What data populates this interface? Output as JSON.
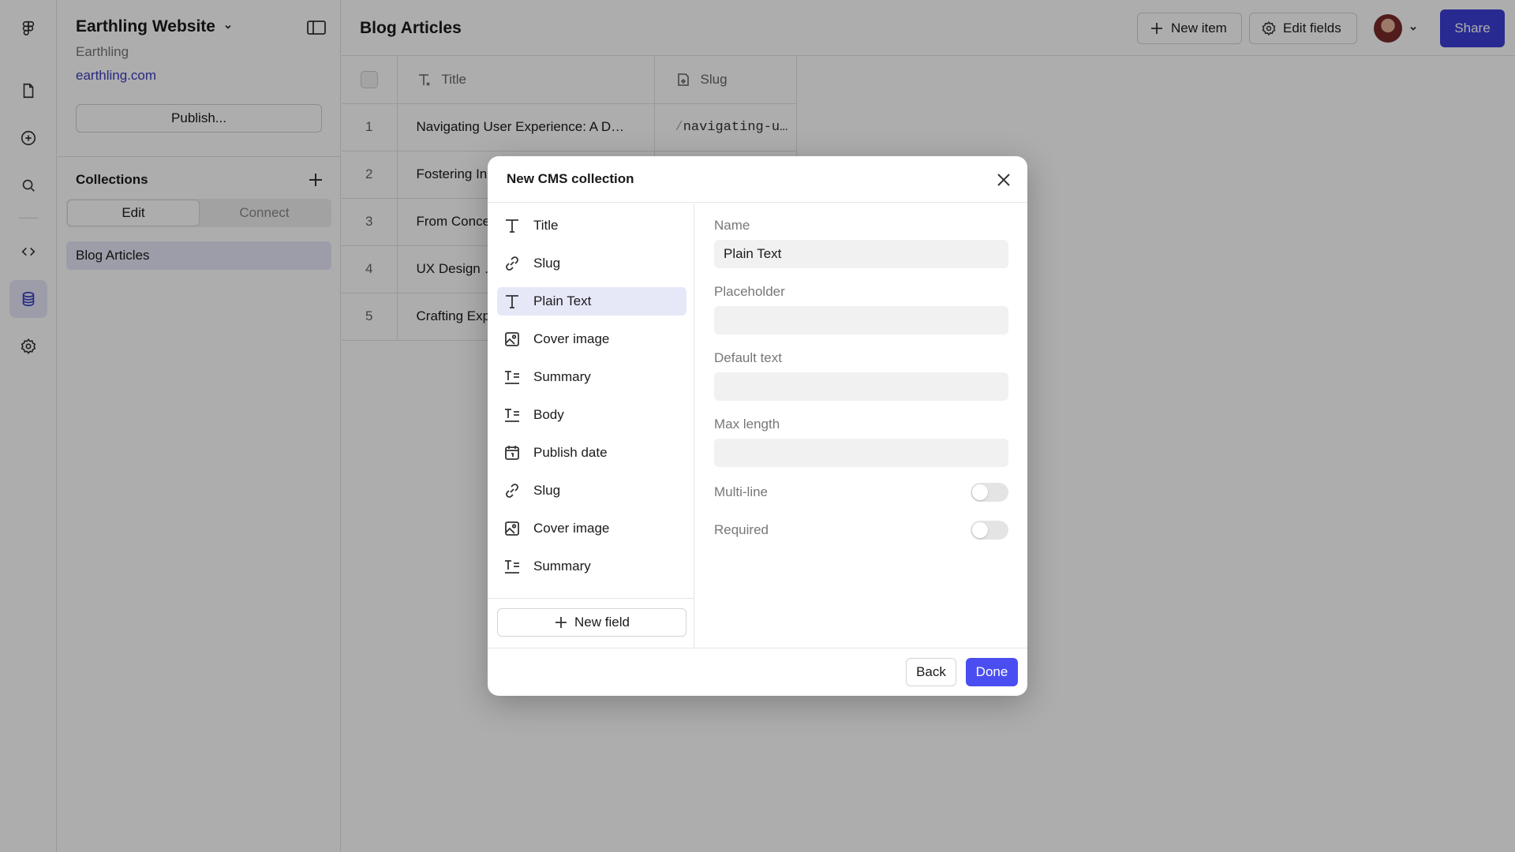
{
  "app": {
    "project_name": "Earthling Website",
    "workspace": "Earthling",
    "domain": "earthling.com",
    "publish_label": "Publish..."
  },
  "sidebar": {
    "collections_title": "Collections",
    "tabs": [
      {
        "label": "Edit",
        "active": true
      },
      {
        "label": "Connect",
        "active": false
      }
    ],
    "collections": [
      {
        "label": "Blog Articles",
        "selected": true
      }
    ]
  },
  "header": {
    "title": "Blog Articles",
    "new_item_label": "New item",
    "edit_fields_label": "Edit fields",
    "share_label": "Share"
  },
  "table": {
    "columns": [
      "Title",
      "Slug"
    ],
    "rows": [
      {
        "num": "1",
        "title": "Navigating User Experience: A D…",
        "slug": "navigating-u…"
      },
      {
        "num": "2",
        "title": "Fostering In",
        "slug": ""
      },
      {
        "num": "3",
        "title": "From Conce",
        "slug": ""
      },
      {
        "num": "4",
        "title": "UX Design …",
        "slug": ""
      },
      {
        "num": "5",
        "title": "Crafting Exp",
        "slug": ""
      }
    ]
  },
  "modal": {
    "title": "New CMS collection",
    "fields": [
      {
        "label": "Title",
        "icon": "text-type-icon",
        "selected": false
      },
      {
        "label": "Slug",
        "icon": "link-icon",
        "selected": false
      },
      {
        "label": "Plain Text",
        "icon": "text-type-icon",
        "selected": true
      },
      {
        "label": "Cover image",
        "icon": "image-icon",
        "selected": false
      },
      {
        "label": "Summary",
        "icon": "rich-text-icon",
        "selected": false
      },
      {
        "label": "Body",
        "icon": "rich-text-icon",
        "selected": false
      },
      {
        "label": "Publish date",
        "icon": "calendar-icon",
        "selected": false
      },
      {
        "label": "Slug",
        "icon": "link-icon",
        "selected": false
      },
      {
        "label": "Cover image",
        "icon": "image-icon",
        "selected": false
      },
      {
        "label": "Summary",
        "icon": "rich-text-icon",
        "selected": false
      }
    ],
    "new_field_label": "New field",
    "form": {
      "name_label": "Name",
      "name_value": "Plain Text",
      "placeholder_label": "Placeholder",
      "placeholder_value": "",
      "default_label": "Default text",
      "default_value": "",
      "maxlength_label": "Max length",
      "maxlength_value": "",
      "multiline_label": "Multi-line",
      "multiline_on": false,
      "required_label": "Required",
      "required_on": false
    },
    "back_label": "Back",
    "done_label": "Done"
  },
  "colors": {
    "accent": "#3b3fd6",
    "done_button": "#4a4ef0",
    "selection": "#e6e8f8",
    "link": "#3a3dbd"
  }
}
